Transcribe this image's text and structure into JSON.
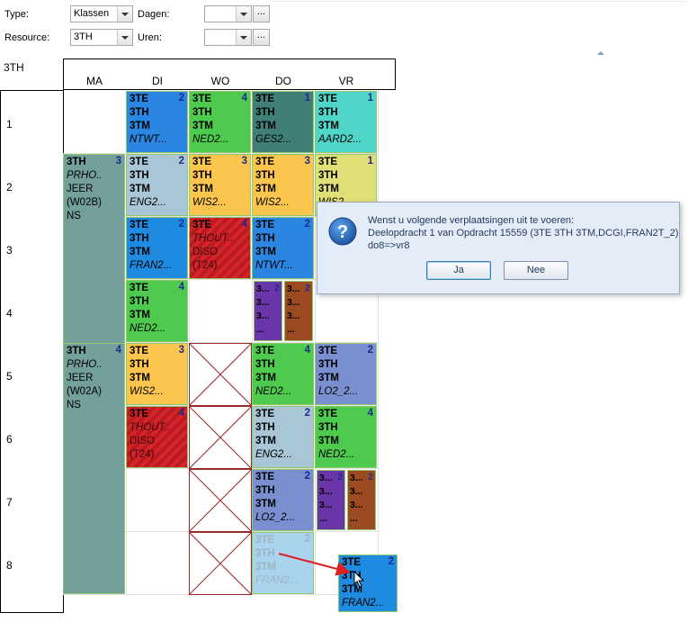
{
  "filters": {
    "type_label": "Type:",
    "type_value": "Klassen",
    "resource_label": "Resource:",
    "resource_value": "3TH",
    "days_label": "Dagen:",
    "days_value": "",
    "hours_label": "Uren:",
    "hours_value": "",
    "ellipsis": "..."
  },
  "grid": {
    "title": "3TH",
    "days": [
      "MA",
      "DI",
      "WO",
      "DO",
      "VR"
    ],
    "periods": [
      "1",
      "2",
      "3",
      "4",
      "5",
      "6",
      "7",
      "8"
    ]
  },
  "lessons": [
    {
      "id": "d1",
      "lines": [
        "3TE",
        "3TH",
        "3TM",
        "NTWT..."
      ],
      "count": "2",
      "color": "#2a86e0"
    },
    {
      "id": "w1",
      "lines": [
        "3TE",
        "3TH",
        "3TM",
        "NED2..."
      ],
      "count": "4",
      "color": "#4ecb4e"
    },
    {
      "id": "do1",
      "lines": [
        "3TE",
        "3TH",
        "3TM",
        "GES2..."
      ],
      "count": "1",
      "color": "#3f7f76"
    },
    {
      "id": "v1",
      "lines": [
        "3TE",
        "3TH",
        "3TM",
        "AARD2..."
      ],
      "count": "1",
      "color": "#4fd6c8"
    },
    {
      "id": "m2",
      "lines": [
        "3TH",
        "PRHO..",
        "JEER",
        "(W02B)",
        "NS"
      ],
      "count": "3",
      "color": "#74a09c"
    },
    {
      "id": "d2",
      "lines": [
        "3TE",
        "3TH",
        "3TM",
        "ENG2..."
      ],
      "count": "2",
      "color": "#a9c6d6"
    },
    {
      "id": "w2",
      "lines": [
        "3TE",
        "3TH",
        "3TM",
        "WIS2..."
      ],
      "count": "3",
      "color": "#fcc64e"
    },
    {
      "id": "do2",
      "lines": [
        "3TE",
        "3TH",
        "3TM",
        "WIS2..."
      ],
      "count": "3",
      "color": "#fcc64e"
    },
    {
      "id": "v2",
      "lines": [
        "3TE",
        "3TH",
        "3TM",
        "WIS2..."
      ],
      "count": "1",
      "color": "#e1e077"
    },
    {
      "id": "d3",
      "lines": [
        "3TE",
        "3TH",
        "3TM",
        "FRAN2..."
      ],
      "count": "2",
      "color": "#1f8be0"
    },
    {
      "id": "w3",
      "lines": [
        "3TE",
        "THOUT..",
        "DISO",
        "(T24)"
      ],
      "count": "4",
      "color": "#d8232a"
    },
    {
      "id": "do3",
      "lines": [
        "3TE",
        "3TH",
        "3TM",
        "NTWT..."
      ],
      "count": "2",
      "color": "#2a86e0"
    },
    {
      "id": "d4",
      "lines": [
        "3TE",
        "3TH",
        "3TM",
        "NED2..."
      ],
      "count": "4",
      "color": "#4ecb4e"
    },
    {
      "id": "do4a",
      "lines": [
        "3...",
        "3...",
        "3...",
        "..."
      ],
      "count": "2",
      "color": "#6a35a8"
    },
    {
      "id": "do4b",
      "lines": [
        "3...",
        "3...",
        "3...",
        "..."
      ],
      "count": "2",
      "color": "#9c4a22"
    },
    {
      "id": "m5",
      "lines": [
        "3TH",
        "PRHO..",
        "JEER",
        "(W02A)",
        "NS"
      ],
      "count": "4",
      "color": "#74a09c"
    },
    {
      "id": "d5",
      "lines": [
        "3TE",
        "3TH",
        "3TM",
        "WIS2..."
      ],
      "count": "3",
      "color": "#fcc64e"
    },
    {
      "id": "do5",
      "lines": [
        "3TE",
        "3TH",
        "3TM",
        "NED2..."
      ],
      "count": "4",
      "color": "#4ecb4e"
    },
    {
      "id": "v5",
      "lines": [
        "3TE",
        "3TH",
        "3TM",
        "LO2_2..."
      ],
      "count": "2",
      "color": "#7a8fcf"
    },
    {
      "id": "d6",
      "lines": [
        "3TE",
        "THOUT..",
        "DISO",
        "(T24)"
      ],
      "count": "4",
      "color": "#d8232a"
    },
    {
      "id": "do6",
      "lines": [
        "3TE",
        "3TH",
        "3TM",
        "ENG2..."
      ],
      "count": "2",
      "color": "#a9c6d6"
    },
    {
      "id": "v6",
      "lines": [
        "3TE",
        "3TH",
        "3TM",
        "NED2..."
      ],
      "count": "4",
      "color": "#4ecb4e"
    },
    {
      "id": "do7",
      "lines": [
        "3TE",
        "3TH",
        "3TM",
        "LO2_2..."
      ],
      "count": "2",
      "color": "#7a8fcf"
    },
    {
      "id": "v7a",
      "lines": [
        "3...",
        "3...",
        "3...",
        "..."
      ],
      "count": "2",
      "color": "#6a35a8"
    },
    {
      "id": "v7b",
      "lines": [
        "3...",
        "3...",
        "3...",
        "..."
      ],
      "count": "2",
      "color": "#9c4a22"
    },
    {
      "id": "do8",
      "lines": [
        "3TE",
        "3TH",
        "3TM",
        "FRAN2..."
      ],
      "count": "2",
      "color": "#a8d4ee"
    },
    {
      "id": "drag",
      "lines": [
        "3TE",
        "3TH",
        "3TM",
        "FRAN2..."
      ],
      "count": "2",
      "color": "#1f8be0"
    }
  ],
  "dialog": {
    "line1": "Wenst u volgende verplaatsingen uit te voeren:",
    "line2": "Deelopdracht 1 van Opdracht 15559 (3TE 3TH 3TM,DCGI,FRAN2T_2)",
    "line3": "do8=>vr8",
    "yes": "Ja",
    "no": "Nee",
    "icon": "question-icon"
  },
  "colors": {
    "grid_line": "#e0e0e0",
    "unavailable_x": "#9d2a2a",
    "drag_arrow": "#e02020"
  }
}
